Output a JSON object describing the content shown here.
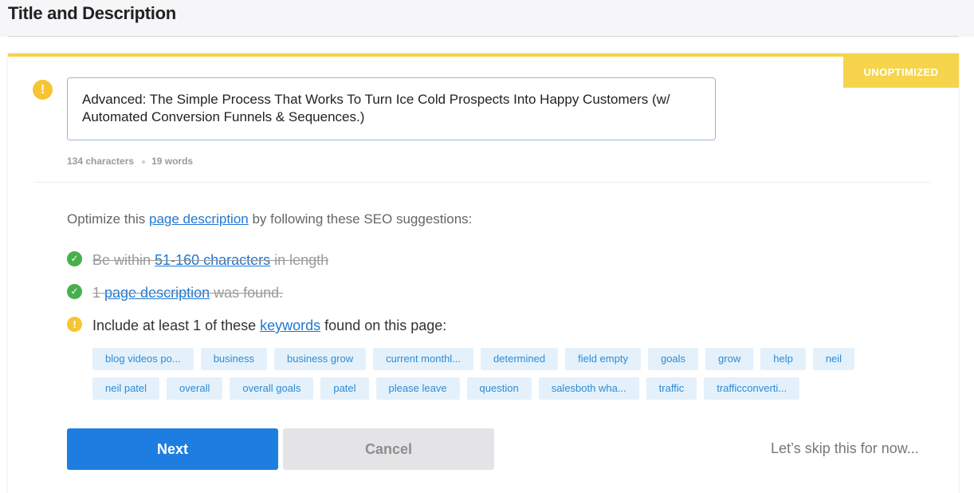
{
  "header": {
    "title": "Title and Description"
  },
  "card": {
    "status_badge": "UNOPTIMIZED",
    "warning_glyph": "!",
    "description_text": "Advanced: The Simple Process That Works To Turn Ice Cold Prospects Into Happy Customers (w/ Automated Conversion Funnels & Sequences.)",
    "char_count": "134 characters",
    "word_count": "19 words"
  },
  "suggestions": {
    "intro_prefix": "Optimize this ",
    "intro_link": "page description",
    "intro_suffix": " by following these SEO suggestions:",
    "items": [
      {
        "prefix": "Be within ",
        "link": "51-160 characters",
        "suffix": " in length",
        "status": "done"
      },
      {
        "prefix": "1 ",
        "link": "page description",
        "suffix": " was found.",
        "status": "done"
      },
      {
        "prefix": "Include at least 1 of these ",
        "link": "keywords",
        "suffix": " found on this page:",
        "status": "warning"
      }
    ],
    "check_glyph": "✓"
  },
  "keywords": {
    "row1": [
      "blog videos po...",
      "business",
      "business grow",
      "current monthl...",
      "determined",
      "field empty",
      "goals",
      "grow",
      "help",
      "neil"
    ],
    "row2": [
      "neil patel",
      "overall",
      "overall goals",
      "patel",
      "please leave",
      "question",
      "salesboth wha...",
      "traffic",
      "trafficconverti..."
    ]
  },
  "actions": {
    "next_label": "Next",
    "cancel_label": "Cancel",
    "skip_label": "Let’s skip this for now..."
  },
  "colors": {
    "accent": "#1e7de0",
    "warning": "#f7c531",
    "success": "#47b04b",
    "badge": "#f6d54d",
    "tag_bg": "#e4f1fb",
    "tag_text": "#2c8bd6"
  },
  "icons": {
    "warning": "exclamation-circle-icon",
    "success": "check-circle-icon"
  }
}
